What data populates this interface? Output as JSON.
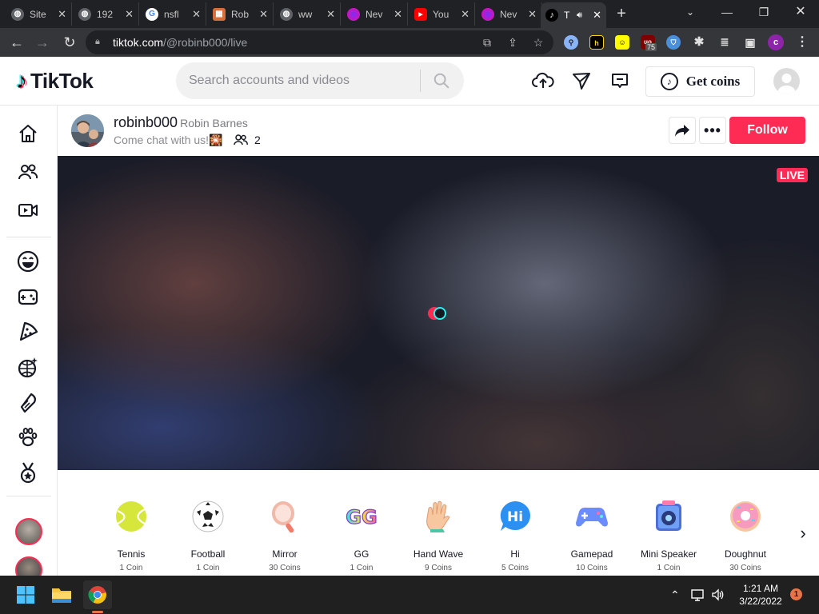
{
  "browser": {
    "tabs": [
      {
        "title": "Site",
        "favicon": "globe-icon",
        "color": "#9aa0a6"
      },
      {
        "title": "192",
        "favicon": "globe-icon",
        "color": "#9aa0a6"
      },
      {
        "title": "nsfl",
        "favicon": "google-icon",
        "color": "#4285f4"
      },
      {
        "title": "Rob",
        "favicon": "image-icon",
        "color": "#d56e3b"
      },
      {
        "title": "ww",
        "favicon": "globe-icon",
        "color": "#9aa0a6"
      },
      {
        "title": "Nev",
        "favicon": "purple-swirl-icon",
        "color": "#c13584"
      },
      {
        "title": "You",
        "favicon": "youtube-icon",
        "color": "#ff0000"
      },
      {
        "title": "Nev",
        "favicon": "purple-swirl-icon",
        "color": "#c13584"
      },
      {
        "title": "T",
        "favicon": "tiktok-icon",
        "color": "#000000"
      }
    ],
    "new_tab": "+",
    "url_host": "tiktok.com",
    "url_path": "/@robinb000/live",
    "extensions": {
      "ublock_count": "75",
      "profile_initial": "c"
    }
  },
  "tiktok": {
    "logo_text": "TikTok",
    "search_placeholder": "Search accounts and videos",
    "get_coins": "Get coins",
    "host": {
      "username": "robinb000",
      "nickname": "Robin Barnes",
      "description": "Come chat with us!🎇",
      "viewer_count": "2"
    },
    "follow_label": "Follow",
    "live_badge": "LIVE",
    "more_label": "•••",
    "gifts": [
      {
        "name": "Tennis",
        "price": "1 Coin"
      },
      {
        "name": "Football",
        "price": "1 Coin"
      },
      {
        "name": "Mirror",
        "price": "30 Coins"
      },
      {
        "name": "GG",
        "price": "1 Coin"
      },
      {
        "name": "Hand Wave",
        "price": "9 Coins"
      },
      {
        "name": "Hi",
        "price": "5 Coins"
      },
      {
        "name": "Gamepad",
        "price": "10 Coins"
      },
      {
        "name": "Mini Speaker",
        "price": "1 Coin"
      },
      {
        "name": "Doughnut",
        "price": "30 Coins"
      }
    ],
    "gift_art": {
      "gg": "GG",
      "hi": "Hi"
    }
  },
  "taskbar": {
    "time": "1:21 AM",
    "date": "3/22/2022",
    "notification_count": "1"
  },
  "colors": {
    "brand_red": "#fe2c55",
    "brand_cyan": "#25f4ee",
    "chrome_dark": "#202124",
    "taskbar": "#202020"
  }
}
